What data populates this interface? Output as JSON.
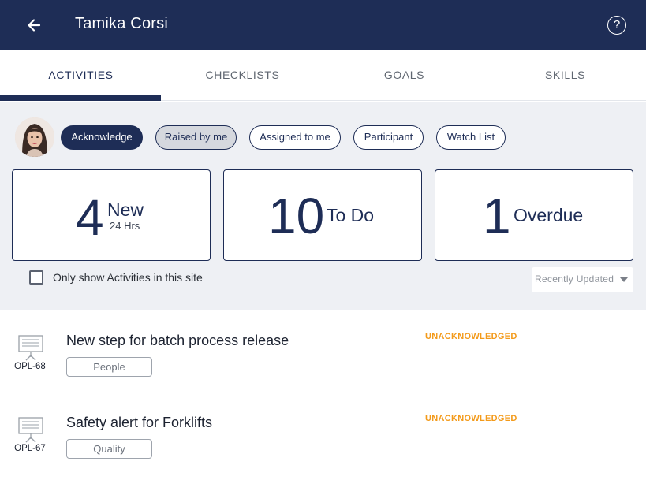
{
  "header": {
    "title": "Tamika Corsi",
    "back_icon": "arrow-left-icon",
    "help_icon": "question-circle-icon",
    "help_glyph": "?",
    "background_color": "#1e2d56"
  },
  "tabs": [
    {
      "label": "ACTIVITIES",
      "active": true
    },
    {
      "label": "CHECKLISTS",
      "active": false
    },
    {
      "label": "GOALS",
      "active": false
    },
    {
      "label": "SKILLS",
      "active": false
    }
  ],
  "filters": [
    {
      "label": "Acknowledge",
      "state": "filled"
    },
    {
      "label": "Raised by me",
      "state": "selected"
    },
    {
      "label": "Assigned to me",
      "state": "outline"
    },
    {
      "label": "Participant",
      "state": "outline"
    },
    {
      "label": "Watch List",
      "state": "outline"
    }
  ],
  "stats": {
    "new": {
      "count": "4",
      "label": "New",
      "sub": "24 Hrs"
    },
    "todo": {
      "count": "10",
      "label": "To Do"
    },
    "overdue": {
      "count": "1",
      "label": "Overdue"
    }
  },
  "site_filter": {
    "label": "Only show Activities in this site",
    "checked": false
  },
  "sort": {
    "value": "Recently Updated",
    "icon": "caret-down-icon"
  },
  "activities": [
    {
      "id": "OPL-68",
      "title": "New step for batch process release",
      "tag": "People",
      "status": "UNACKNOWLEDGED",
      "icon": "presentation-board-icon"
    },
    {
      "id": "OPL-67",
      "title": "Safety alert for Forklifts",
      "tag": "Quality",
      "status": "UNACKNOWLEDGED",
      "icon": "presentation-board-icon"
    }
  ],
  "colors": {
    "primary": "#1e2d56",
    "status_unacknowledged": "#f39a1a",
    "panel_background": "#eef0f4"
  }
}
